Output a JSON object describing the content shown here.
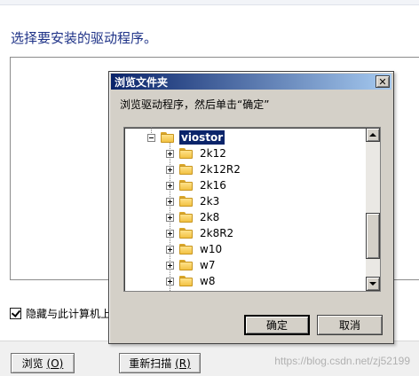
{
  "wizard": {
    "heading": "选择要安装的驱动程序。",
    "checkbox_label": "隐藏与此计算机上",
    "checkbox_checked": true,
    "browse_label": "浏览",
    "browse_accel": "(O)",
    "rescan_label": "重新扫描",
    "rescan_accel": "(R)"
  },
  "dialog": {
    "title": "浏览文件夹",
    "close_symbol": "✕",
    "instruction": "浏览驱动程序，然后单击“确定”",
    "ok_label": "确定",
    "cancel_label": "取消",
    "tree": {
      "root": "viostor",
      "children": [
        "2k12",
        "2k12R2",
        "2k16",
        "2k3",
        "2k8",
        "2k8R2",
        "w10",
        "w7",
        "w8"
      ]
    }
  },
  "watermark": "https://blog.csdn.net/zj52199",
  "colors": {
    "titlebar_start": "#0a246a",
    "titlebar_end": "#a6caf0",
    "heading": "#1e3287",
    "selection": "#0a246a"
  },
  "icons": {
    "folder": "folder-icon",
    "expand": "plus-box-icon",
    "collapse": "minus-box-icon"
  }
}
